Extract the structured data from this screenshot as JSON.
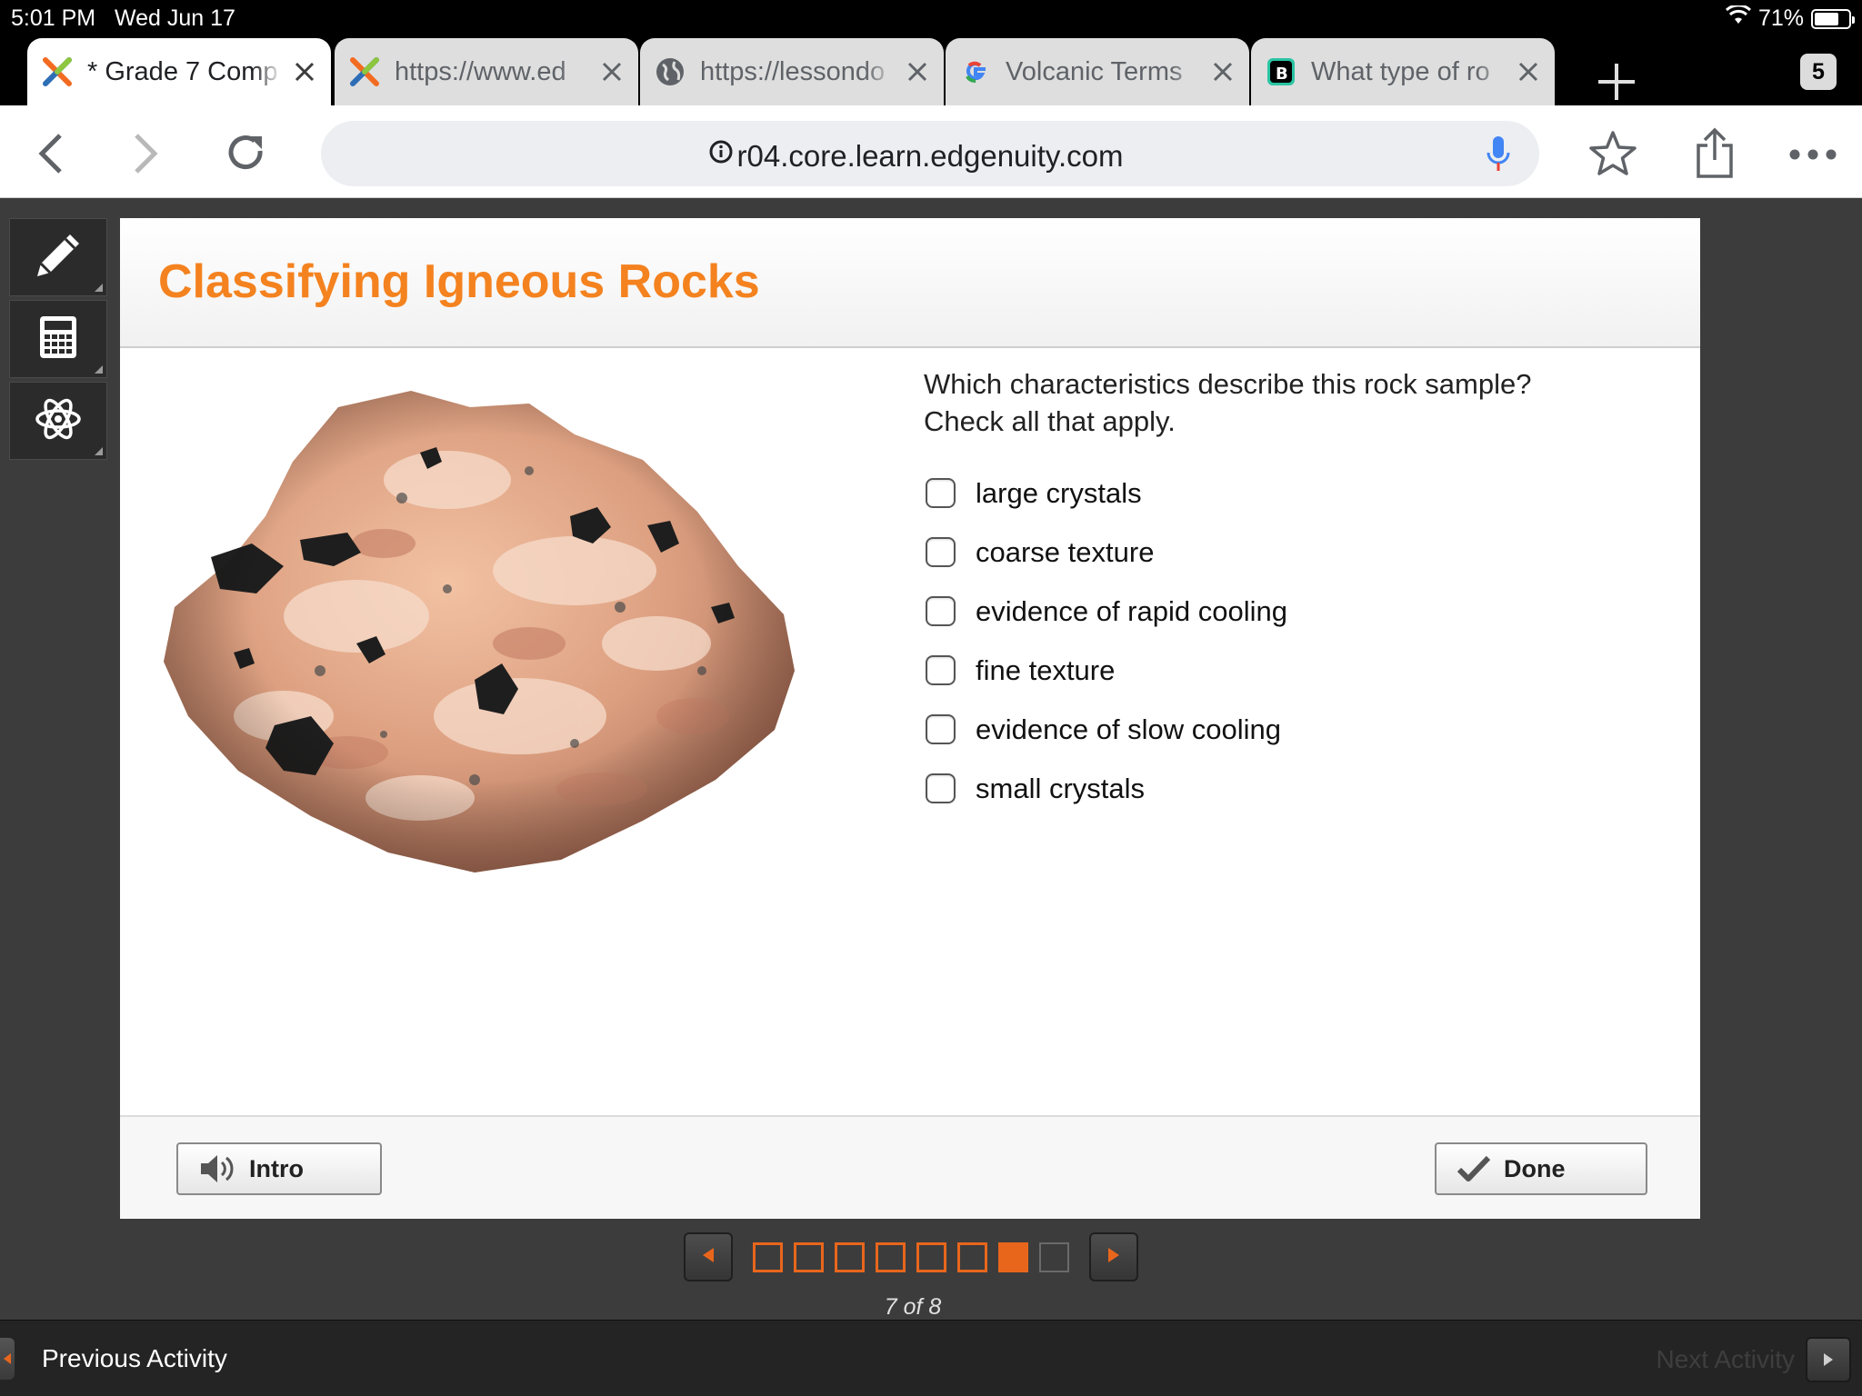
{
  "status_bar": {
    "time": "5:01 PM",
    "date": "Wed Jun 17",
    "battery_percent": "71%",
    "battery_level": 0.71
  },
  "tabs": [
    {
      "title": "* Grade 7 Comp",
      "favicon": "edgenuity-x-icon",
      "active": true
    },
    {
      "title": "https://www.ed",
      "favicon": "edgenuity-x-icon",
      "active": false
    },
    {
      "title": "https://lessondo",
      "favicon": "globe-icon",
      "active": false
    },
    {
      "title": "Volcanic Terms",
      "favicon": "google-g-icon",
      "active": false
    },
    {
      "title": "What type of ro",
      "favicon": "brainly-b-icon",
      "active": false
    }
  ],
  "tab_count": "5",
  "address_bar": {
    "url": "r04.core.learn.edgenuity.com"
  },
  "tools": [
    "pencil-icon",
    "calculator-icon",
    "atom-icon"
  ],
  "activity": {
    "title": "Classifying Igneous Rocks",
    "question_line1": "Which characteristics describe this rock sample?",
    "question_line2": "Check all that apply.",
    "options": [
      {
        "label": "large crystals",
        "checked": false
      },
      {
        "label": "coarse texture",
        "checked": false
      },
      {
        "label": "evidence of rapid cooling",
        "checked": false
      },
      {
        "label": "fine texture",
        "checked": false
      },
      {
        "label": "evidence of slow cooling",
        "checked": false
      },
      {
        "label": "small crystals",
        "checked": false
      }
    ],
    "intro_label": "Intro",
    "done_label": "Done"
  },
  "pager": {
    "total": 8,
    "current": 7,
    "label": "7 of 8"
  },
  "bottom_nav": {
    "previous_label": "Previous Activity",
    "next_label": "Next Activity"
  },
  "colors": {
    "accent_orange": "#f4821f",
    "pager_orange": "#e8661c"
  }
}
